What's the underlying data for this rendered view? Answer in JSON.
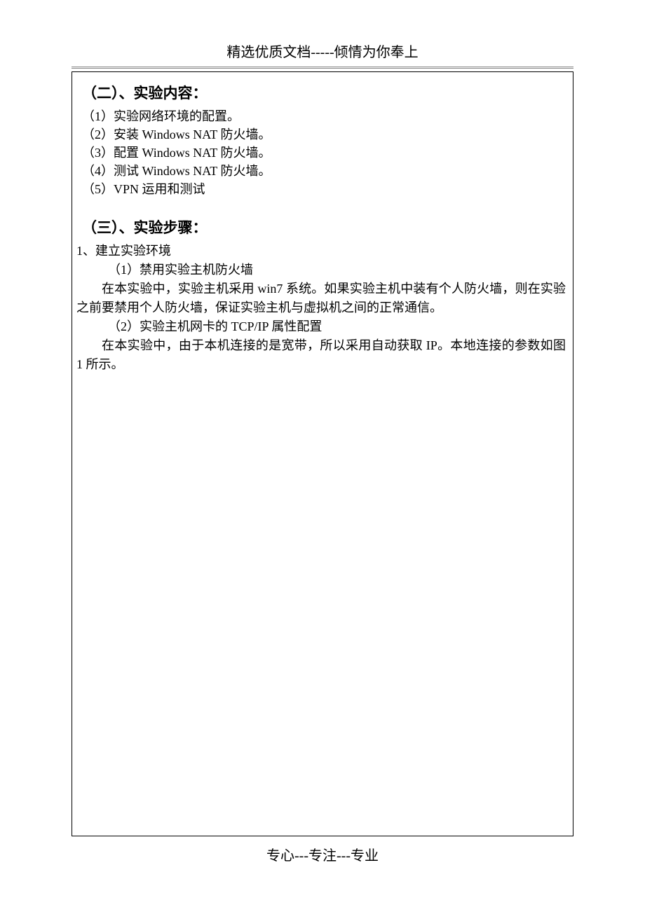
{
  "header": {
    "title": "精选优质文档-----倾情为你奉上"
  },
  "section2": {
    "heading": "（二）、实验内容：",
    "items": [
      "（1）实验网络环境的配置。",
      "（2）安装 Windows NAT 防火墙。",
      "（3）配置 Windows NAT 防火墙。",
      "（4）测试 Windows NAT 防火墙。",
      "（5）VPN 运用和测试"
    ]
  },
  "section3": {
    "heading": "（三）、实验步骤：",
    "step_title": "1、建立实验环境",
    "sub1_title": "（1）禁用实验主机防火墙",
    "sub1_body": "在本实验中，实验主机采用 win7 系统。如果实验主机中装有个人防火墙，则在实验之前要禁用个人防火墙，保证实验主机与虚拟机之间的正常通信。",
    "sub2_title": "（2）实验主机网卡的 TCP/IP 属性配置",
    "sub2_body": "在本实验中，由于本机连接的是宽带，所以采用自动获取 IP。本地连接的参数如图 1 所示。"
  },
  "footer": {
    "text": "专心---专注---专业"
  }
}
